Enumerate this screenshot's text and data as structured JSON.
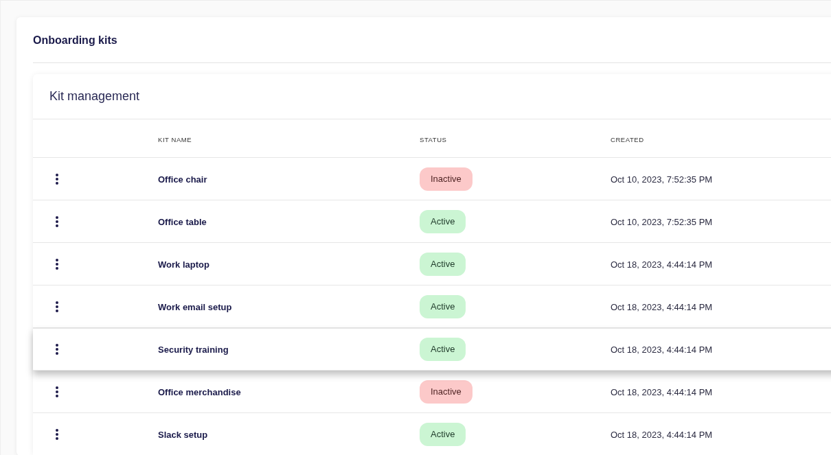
{
  "page": {
    "title": "Onboarding kits"
  },
  "card": {
    "title": "Kit management",
    "columns": [
      "KIT NAME",
      "STATUS",
      "CREATED"
    ],
    "rows": [
      {
        "name": "Office chair",
        "status": "Inactive",
        "active": false,
        "created": "Oct 10, 2023, 7:52:35 PM",
        "raised": false
      },
      {
        "name": "Office table",
        "status": "Active",
        "active": true,
        "created": "Oct 10, 2023, 7:52:35 PM",
        "raised": false
      },
      {
        "name": "Work laptop",
        "status": "Active",
        "active": true,
        "created": "Oct 18, 2023, 4:44:14 PM",
        "raised": false
      },
      {
        "name": "Work email setup",
        "status": "Active",
        "active": true,
        "created": "Oct 18, 2023, 4:44:14 PM",
        "raised": false
      },
      {
        "name": "Security training",
        "status": "Active",
        "active": true,
        "created": "Oct 18, 2023, 4:44:14 PM",
        "raised": true
      },
      {
        "name": "Office merchandise",
        "status": "Inactive",
        "active": false,
        "created": "Oct 18, 2023, 4:44:14 PM",
        "raised": false
      },
      {
        "name": "Slack setup",
        "status": "Active",
        "active": true,
        "created": "Oct 18, 2023, 4:44:14 PM",
        "raised": false
      }
    ]
  }
}
